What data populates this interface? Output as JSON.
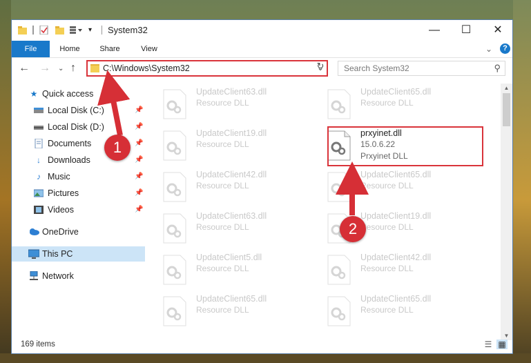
{
  "window": {
    "title": "System32"
  },
  "ribbon": {
    "tabs": [
      "File",
      "Home",
      "Share",
      "View"
    ]
  },
  "address": {
    "path": "C:\\Windows\\System32"
  },
  "search": {
    "placeholder": "Search System32"
  },
  "sidebar": {
    "items": [
      {
        "label": "Quick access",
        "icon": "star-icon"
      },
      {
        "label": "Local Disk (C:)",
        "icon": "drive-icon"
      },
      {
        "label": "Local Disk (D:)",
        "icon": "drive-icon"
      },
      {
        "label": "Documents",
        "icon": "documents-icon"
      },
      {
        "label": "Downloads",
        "icon": "downloads-icon"
      },
      {
        "label": "Music",
        "icon": "music-icon"
      },
      {
        "label": "Pictures",
        "icon": "pictures-icon"
      },
      {
        "label": "Videos",
        "icon": "videos-icon"
      },
      {
        "label": "OneDrive",
        "icon": "cloud-icon"
      },
      {
        "label": "This PC",
        "icon": "computer-icon"
      },
      {
        "label": "Network",
        "icon": "network-icon"
      }
    ]
  },
  "files": {
    "left": [
      {
        "name": "UpdateClient63.dll",
        "type": "Resource DLL"
      },
      {
        "name": "UpdateClient19.dll",
        "type": "Resource DLL"
      },
      {
        "name": "UpdateClient42.dll",
        "type": "Resource DLL"
      },
      {
        "name": "UpdateClient63.dll",
        "type": "Resource DLL"
      },
      {
        "name": "UpdateClient5.dll",
        "type": "Resource DLL"
      },
      {
        "name": "UpdateClient65.dll",
        "type": "Resource DLL"
      }
    ],
    "right": [
      {
        "name": "UpdateClient65.dll",
        "type": "Resource DLL"
      },
      {
        "name": "prxyinet.dll",
        "version": "15.0.6.22",
        "type": "Prxyinet DLL"
      },
      {
        "name": "UpdateClient65.dll",
        "type": "Resource DLL"
      },
      {
        "name": "UpdateClient19.dll",
        "type": "Resource DLL"
      },
      {
        "name": "UpdateClient42.dll",
        "type": "Resource DLL"
      },
      {
        "name": "UpdateClient65.dll",
        "type": "Resource DLL"
      }
    ]
  },
  "status": {
    "item_count": "169 items"
  },
  "annotations": {
    "step1": "1",
    "step2": "2"
  },
  "colors": {
    "accent": "#1979ca",
    "highlight": "#d9333a",
    "selection": "#cce4f7"
  }
}
